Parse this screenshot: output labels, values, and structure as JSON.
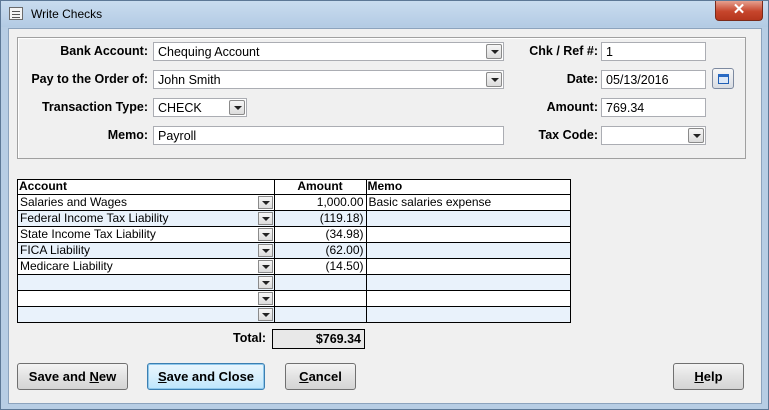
{
  "window": {
    "title": "Write Checks",
    "close_label": "✕"
  },
  "form": {
    "bank_account": {
      "label": "Bank Account:",
      "value": "Chequing Account"
    },
    "pay_to": {
      "label": "Pay to the Order of:",
      "value": "John Smith"
    },
    "transaction_type": {
      "label": "Transaction Type:",
      "value": "CHECK"
    },
    "memo": {
      "label": "Memo:",
      "value": "Payroll"
    },
    "chk_ref": {
      "label": "Chk / Ref #:",
      "value": "1"
    },
    "date": {
      "label": "Date:",
      "value": "05/13/2016"
    },
    "amount": {
      "label": "Amount:",
      "value": "769.34"
    },
    "tax_code": {
      "label": "Tax Code:",
      "value": ""
    }
  },
  "grid": {
    "headers": {
      "account": "Account",
      "amount": "Amount",
      "memo": "Memo"
    },
    "rows": [
      {
        "account": "Salaries and Wages",
        "amount": "1,000.00",
        "memo": "Basic salaries expense"
      },
      {
        "account": "Federal Income Tax Liability",
        "amount": "(119.18)",
        "memo": ""
      },
      {
        "account": "State Income Tax Liability",
        "amount": "(34.98)",
        "memo": ""
      },
      {
        "account": "FICA Liability",
        "amount": "(62.00)",
        "memo": ""
      },
      {
        "account": "Medicare Liability",
        "amount": "(14.50)",
        "memo": ""
      },
      {
        "account": "",
        "amount": "",
        "memo": ""
      },
      {
        "account": "",
        "amount": "",
        "memo": ""
      },
      {
        "account": "",
        "amount": "",
        "memo": ""
      }
    ]
  },
  "total": {
    "label": "Total:",
    "value": "$769.34"
  },
  "buttons": {
    "save_new": {
      "pre": "Save and ",
      "ul": "N",
      "post": "ew"
    },
    "save_close": {
      "pre": "",
      "ul": "S",
      "post": "ave and Close"
    },
    "cancel": {
      "pre": "",
      "ul": "C",
      "post": "ancel"
    },
    "help": {
      "pre": "",
      "ul": "H",
      "post": "elp"
    }
  }
}
